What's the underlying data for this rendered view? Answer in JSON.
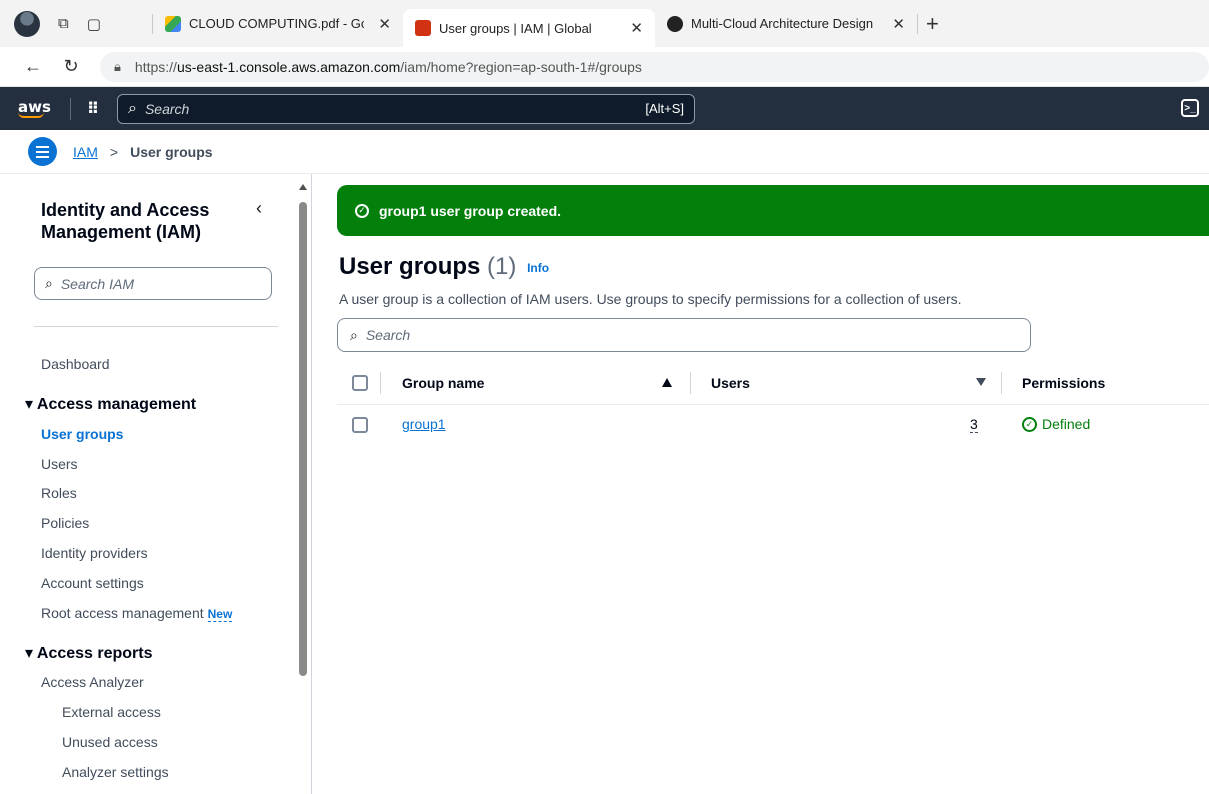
{
  "browser": {
    "tabs": [
      {
        "title": "CLOUD COMPUTING.pdf - Google",
        "favicon": "google-drive-icon"
      },
      {
        "title": "User groups | IAM | Global",
        "favicon": "aws-console-icon"
      },
      {
        "title": "Multi-Cloud Architecture Design",
        "favicon": "chatgpt-icon"
      }
    ],
    "url_prefix": "https://",
    "url_host": "us-east-1.console.aws.amazon.com",
    "url_path": "/iam/home?region=ap-south-1#/groups"
  },
  "awsnav": {
    "logo": "aws",
    "search_placeholder": "Search",
    "search_shortcut": "[Alt+S]"
  },
  "breadcrumb": {
    "root": "IAM",
    "current": "User groups"
  },
  "sidebar": {
    "title": "Identity and Access Management (IAM)",
    "search_placeholder": "Search IAM",
    "dashboard": "Dashboard",
    "access_management": "Access management",
    "am_items": [
      "User groups",
      "Users",
      "Roles",
      "Policies",
      "Identity providers",
      "Account settings",
      "Root access management"
    ],
    "new_badge": "New",
    "access_reports": "Access reports",
    "access_analyzer": "Access Analyzer",
    "analyzer_items": [
      "External access",
      "Unused access",
      "Analyzer settings"
    ]
  },
  "flash": {
    "message": "group1 user group created."
  },
  "main": {
    "title": "User groups",
    "count": "(1)",
    "info": "Info",
    "description": "A user group is a collection of IAM users. Use groups to specify permissions for a collection of users.",
    "search_placeholder": "Search",
    "columns": [
      "Group name",
      "Users",
      "Permissions"
    ],
    "rows": [
      {
        "group_name": "group1",
        "users": "3",
        "permissions": "Defined"
      }
    ]
  },
  "colors": {
    "aws_nav": "#232f3e",
    "link": "#0972d3",
    "success": "#037f0c"
  }
}
